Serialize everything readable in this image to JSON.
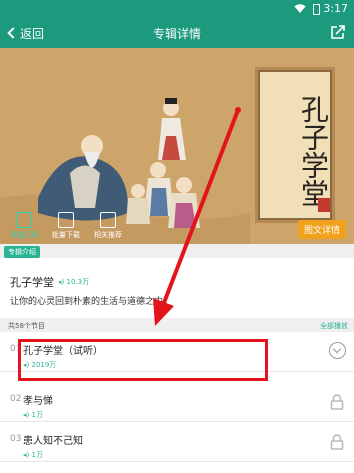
{
  "status_bar": {
    "time": "3:17"
  },
  "header": {
    "back_label": "返回",
    "title": "专辑详情"
  },
  "hero": {
    "scroll_title": "孔子学堂",
    "detail_button": "图文详情",
    "actions": [
      {
        "label": "添加订阅",
        "icon": "subscribe-icon"
      },
      {
        "label": "批量下载",
        "icon": "download-icon"
      },
      {
        "label": "相关推荐",
        "icon": "recommend-icon"
      }
    ]
  },
  "intro": {
    "section_label": "专辑介绍",
    "album_title": "孔子学堂",
    "play_count": "10.3万",
    "description": "让你的心灵回到朴素的生活与道德之中"
  },
  "list": {
    "count_label": "共58个节目",
    "play_all": "全部播放",
    "items": [
      {
        "num": "01",
        "title": "孔子学堂（试听）",
        "plays": "2019万",
        "locked": false
      },
      {
        "num": "02",
        "title": "孝与悌",
        "plays": "1万",
        "locked": true
      },
      {
        "num": "03",
        "title": "患人知不己知",
        "plays": "1万",
        "locked": true
      }
    ]
  },
  "colors": {
    "accent": "#1c9a7d",
    "highlight_red": "#e3141b",
    "button_orange": "#f0a11e"
  }
}
